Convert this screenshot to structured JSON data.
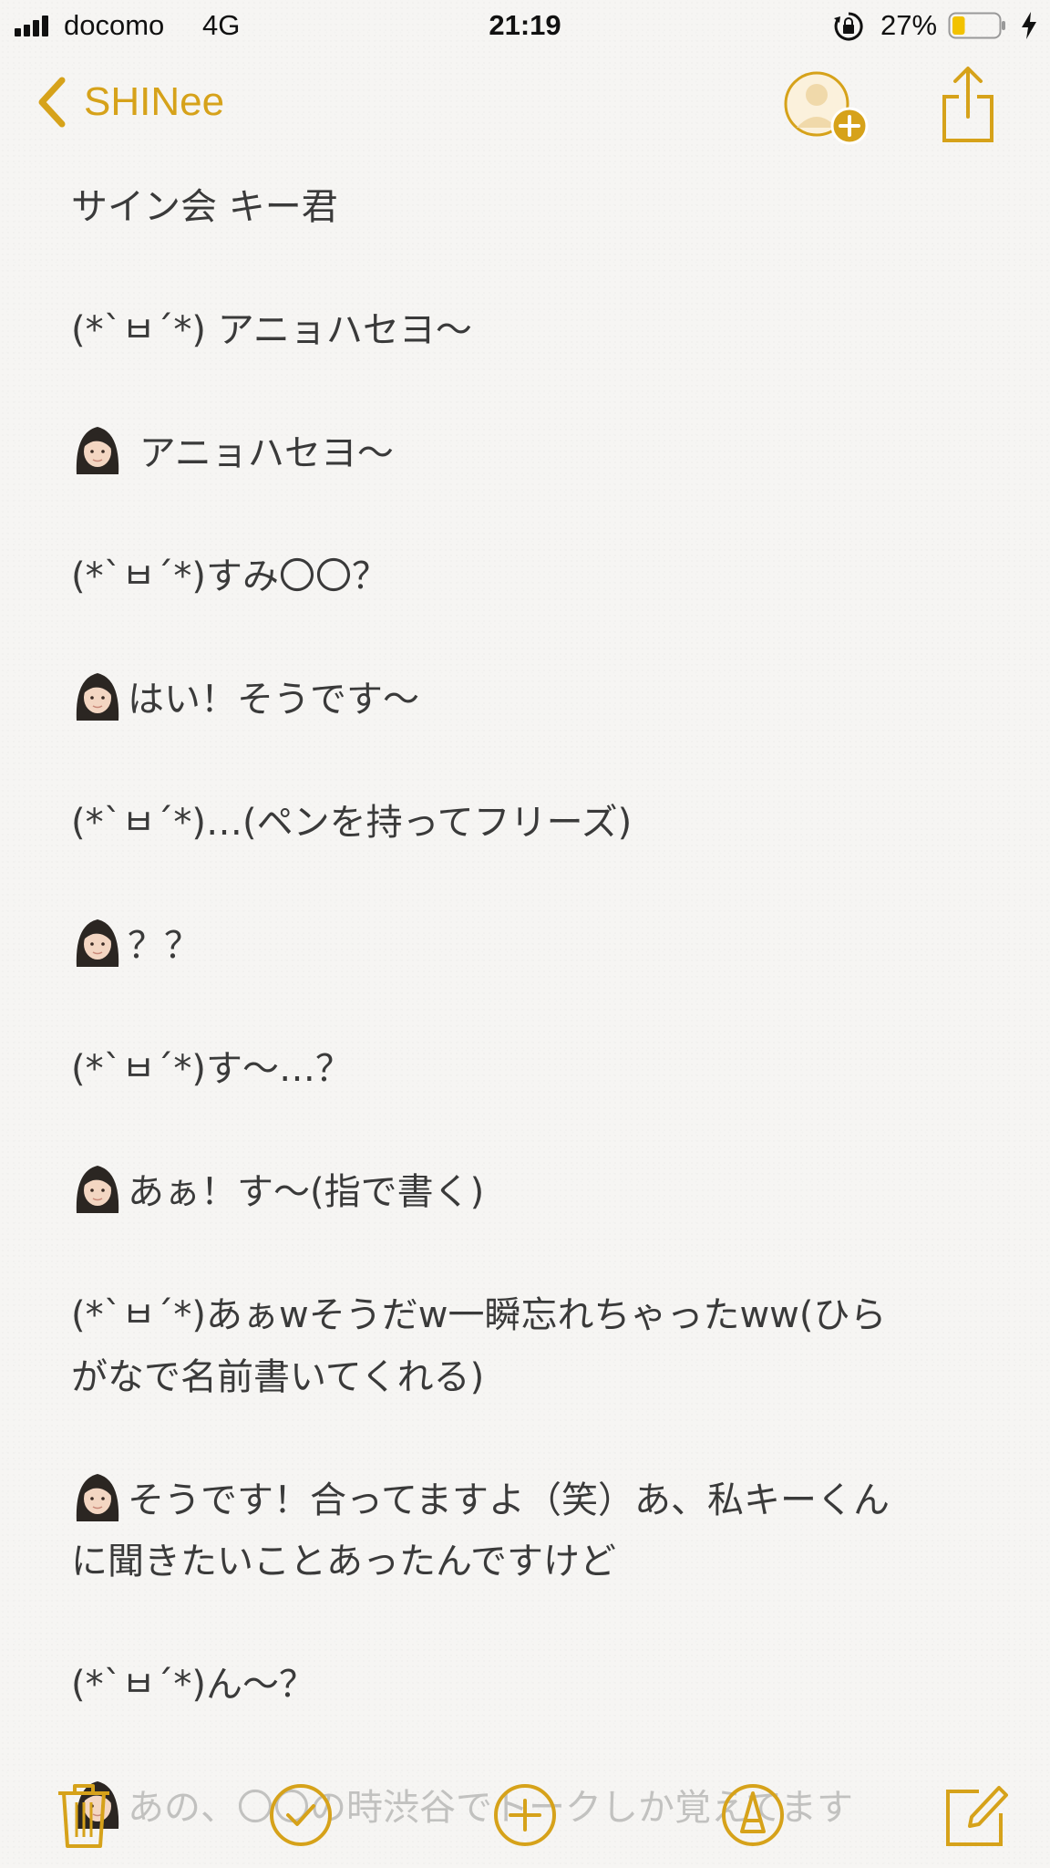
{
  "colors": {
    "accent": "#d6a21a",
    "text": "#3a3a3a",
    "background": "#f6f5f3"
  },
  "status_bar": {
    "carrier": "docomo",
    "network": "4G",
    "time": "21:19",
    "battery_percent": "27%",
    "battery_level": 0.27,
    "icons": [
      "signal-icon",
      "rotation-lock-icon",
      "battery-icon",
      "charging-bolt-icon"
    ]
  },
  "nav": {
    "back_label": "SHINee",
    "icons": [
      "chevron-left-icon",
      "add-person-icon",
      "share-icon"
    ]
  },
  "note": {
    "lines": [
      "サイン会 キー君",
      "",
      "(*`ㅂ´*) アニョハセヨ〜",
      "",
      " アニョハセヨ〜",
      "",
      "(*`ㅂ´*)すみ〇〇？",
      "",
      "はい！そうです〜",
      "",
      "(*`ㅂ´*)…(ペンを持ってフリーズ)",
      "",
      "？？",
      "",
      "(*`ㅂ´*)す〜…？",
      "",
      "あぁ！す〜(指で書く)",
      "",
      "(*`ㅂ´*)あぁwそうだw一瞬忘れちゃったww(ひら",
      "がなで名前書いてくれる)",
      "",
      "そうです！合ってますよ（笑）あ、私キーくん",
      "に聞きたいことあったんですけど",
      "",
      "(*`ㅂ´*)ん〜？",
      "",
      "あの、〇〇の時渋谷でトークしか覚えてます"
    ],
    "emoji_lines": [
      4,
      8,
      12,
      16,
      21,
      26
    ]
  },
  "toolbar": {
    "icons": [
      "trash-icon",
      "checklist-icon",
      "add-icon",
      "markup-icon",
      "compose-icon"
    ]
  }
}
